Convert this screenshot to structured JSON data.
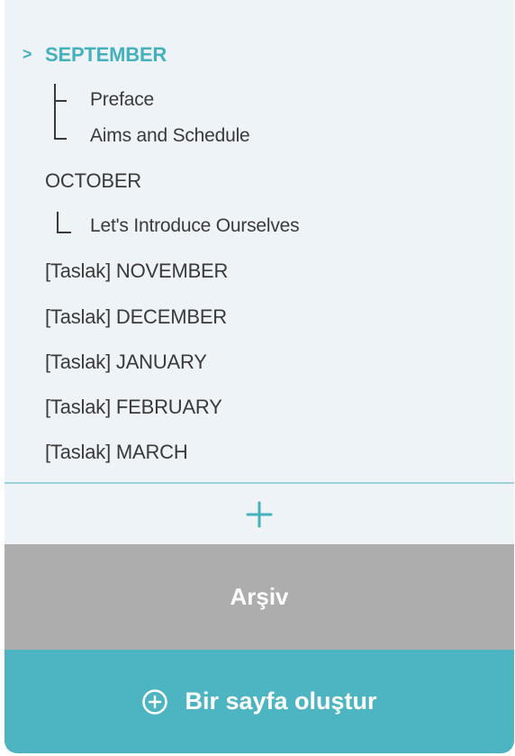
{
  "tree": {
    "expand_glyph": ">",
    "items": [
      {
        "label": "SEPTEMBER",
        "active": true
      },
      {
        "label": "Preface"
      },
      {
        "label": "Aims and Schedule"
      },
      {
        "label": "OCTOBER"
      },
      {
        "label": "Let's Introduce Ourselves"
      },
      {
        "label": "[Taslak] NOVEMBER"
      },
      {
        "label": "[Taslak] DECEMBER"
      },
      {
        "label": "[Taslak] JANUARY"
      },
      {
        "label": "[Taslak] FEBRUARY"
      },
      {
        "label": "[Taslak] MARCH"
      }
    ]
  },
  "add_icon": "plus-icon",
  "archive_label": "Arşiv",
  "create": {
    "label": "Bir sayfa oluştur",
    "icon": "plus-circle-icon"
  },
  "colors": {
    "accent": "#45b0be",
    "panel_bg": "#eef3f7",
    "archive_bg": "#adadad",
    "create_bg": "#4db4c1",
    "text": "#3a3a3a"
  }
}
